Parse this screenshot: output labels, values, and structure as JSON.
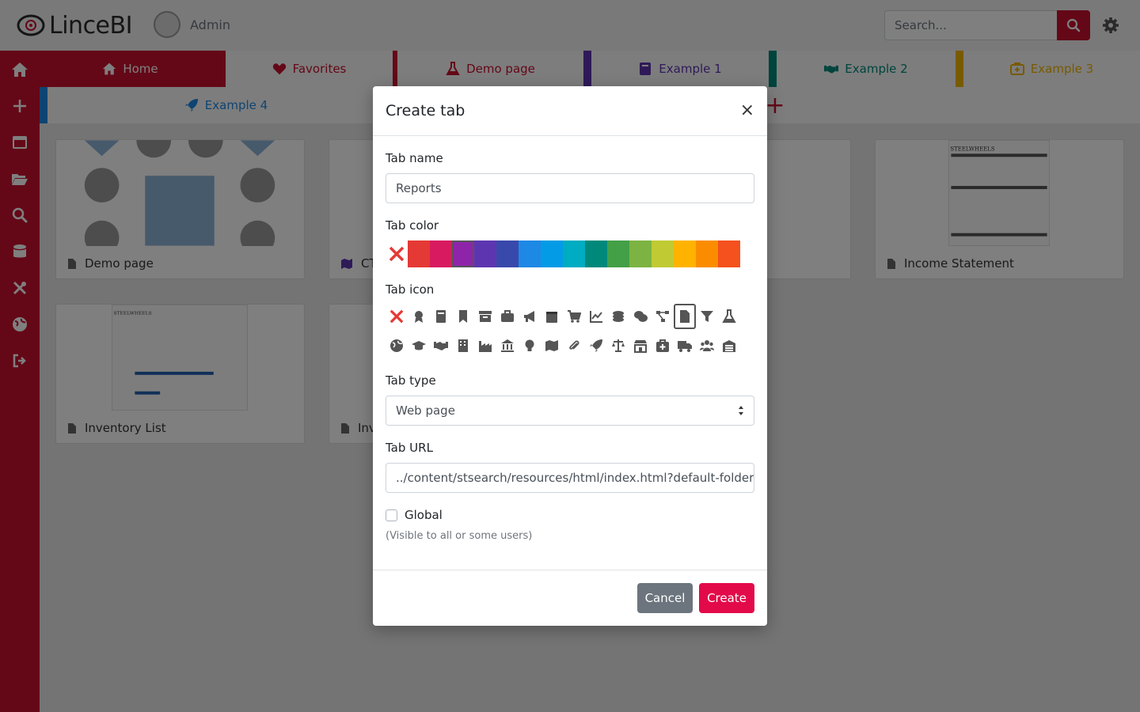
{
  "header": {
    "logo_text": "LinceBI",
    "user_name": "Admin",
    "search_placeholder": "Search..."
  },
  "sidebar": {
    "items": [
      "home-icon",
      "plus-icon",
      "window-icon",
      "folder-open-icon",
      "search-icon",
      "database-icon",
      "tools-icon",
      "globe-icon",
      "sign-out-icon"
    ]
  },
  "tabs": [
    {
      "label": "Home",
      "icon": "home-icon",
      "color": "#ffffff"
    },
    {
      "label": "Favorites",
      "icon": "heart-icon",
      "color": "#c8102e"
    },
    {
      "label": "Demo page",
      "icon": "flask-icon",
      "color": "#c8102e"
    },
    {
      "label": "Example 1",
      "icon": "book-icon",
      "color": "#5e35b1"
    },
    {
      "label": "Example 2",
      "icon": "handshake-icon",
      "color": "#00897b"
    },
    {
      "label": "Example 3",
      "icon": "medkit-icon",
      "color": "#f0b400"
    },
    {
      "label": "Example 4",
      "icon": "rocket-icon",
      "color": "#1e88e5"
    }
  ],
  "cards": [
    {
      "caption": "Demo page"
    },
    {
      "caption": "CT"
    },
    {
      "caption": "Income Statement"
    },
    {
      "caption": "Inventory List"
    },
    {
      "caption": "Inv"
    }
  ],
  "thumb_text": "STEELWHEELS",
  "modal": {
    "title": "Create tab",
    "close": "×",
    "name_label": "Tab name",
    "name_value": "Reports",
    "color_label": "Tab color",
    "colors": [
      "#e53935",
      "#d81b60",
      "#8e24aa",
      "#5e35b1",
      "#3949ab",
      "#1e88e5",
      "#039be5",
      "#00acc1",
      "#00897b",
      "#43a047",
      "#7cb342",
      "#c0ca33",
      "#ffb300",
      "#fb8c00",
      "#f4511e"
    ],
    "icon_label": "Tab icon",
    "icons_row1": [
      "award-icon",
      "book-icon",
      "bookmark-icon",
      "archive-icon",
      "briefcase-icon",
      "bullhorn-icon",
      "calendar-icon",
      "cart-icon",
      "chart-line-icon",
      "coins-icon",
      "comments-dollar-icon",
      "project-diagram-icon",
      "file-icon",
      "filter-icon",
      "flask-icon"
    ],
    "icons_row2": [
      "globe-icon",
      "graduation-cap-icon",
      "handshake-icon",
      "building-icon",
      "industry-icon",
      "university-icon",
      "lightbulb-icon",
      "map-icon",
      "paperclip-icon",
      "rocket-icon",
      "balance-scale-icon",
      "store-icon",
      "medkit-icon",
      "truck-icon",
      "users-icon",
      "warehouse-icon"
    ],
    "type_label": "Tab type",
    "type_value": "Web page",
    "url_label": "Tab URL",
    "url_value": "../content/stsearch/resources/html/index.html?default-folder-pa",
    "global_label": "Global",
    "global_help": "(Visible to all or some users)",
    "cancel": "Cancel",
    "create": "Create"
  }
}
